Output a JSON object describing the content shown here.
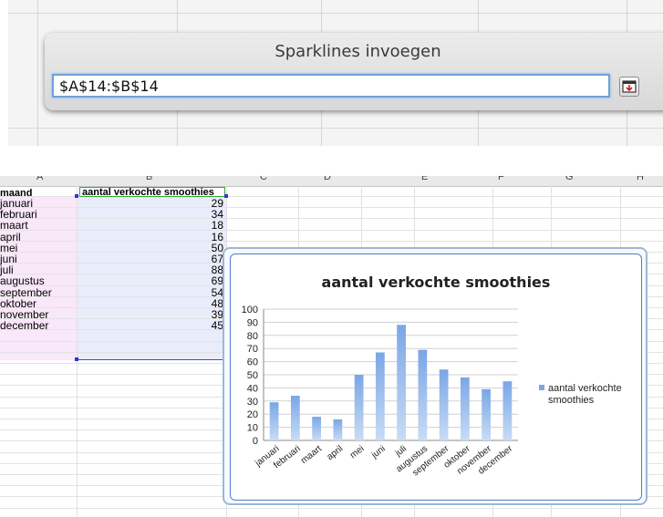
{
  "dialog": {
    "title": "Sparklines invoegen",
    "range_value": "$A$14:$B$14"
  },
  "sheet": {
    "column_letters": [
      "A",
      "B",
      "C",
      "D",
      "E",
      "F",
      "G",
      "H"
    ],
    "header_month": "maand",
    "header_count": "aantal verkochte smoothies",
    "rows": [
      {
        "month": "januari",
        "value": "29"
      },
      {
        "month": "februari",
        "value": "34"
      },
      {
        "month": "maart",
        "value": "18"
      },
      {
        "month": "april",
        "value": "16"
      },
      {
        "month": "mei",
        "value": "50"
      },
      {
        "month": "juni",
        "value": "67"
      },
      {
        "month": "juli",
        "value": "88"
      },
      {
        "month": "augustus",
        "value": "69"
      },
      {
        "month": "september",
        "value": "54"
      },
      {
        "month": "oktober",
        "value": "48"
      },
      {
        "month": "november",
        "value": "39"
      },
      {
        "month": "december",
        "value": "45"
      }
    ],
    "selection_fill": "#e9ecfb",
    "header_border": "#33aa33"
  },
  "chart_data": {
    "type": "bar",
    "title": "aantal verkochte smoothies",
    "categories": [
      "januari",
      "februari",
      "maart",
      "april",
      "mei",
      "juni",
      "juli",
      "augustus",
      "september",
      "oktober",
      "november",
      "december"
    ],
    "series": [
      {
        "name": "aantal verkochte smoothies",
        "values": [
          29,
          34,
          18,
          16,
          50,
          67,
          88,
          69,
          54,
          48,
          39,
          45
        ]
      }
    ],
    "ylim": [
      0,
      100
    ],
    "yticks": [
      0,
      10,
      20,
      30,
      40,
      50,
      60,
      70,
      80,
      90,
      100
    ],
    "grid": true,
    "legend": "right",
    "bar_color": "#7aa6e6"
  }
}
